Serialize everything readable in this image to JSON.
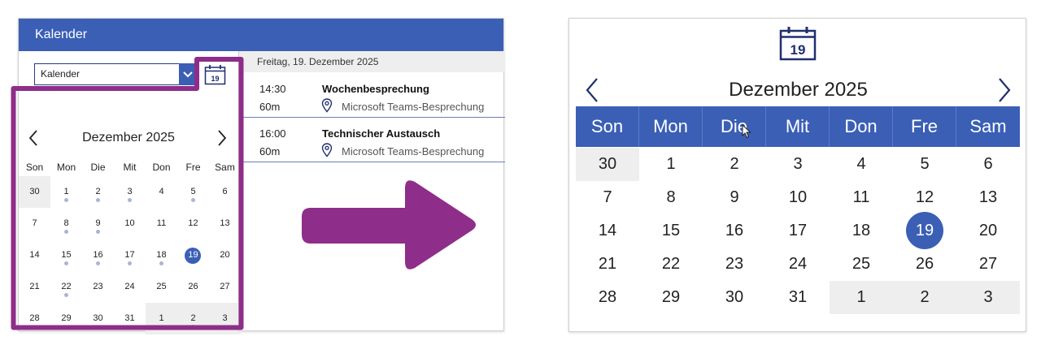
{
  "app": {
    "title": "Kalender",
    "calendar_select_value": "Kalender",
    "small_icon_day": "19",
    "agenda_date": "Freitag, 19. Dezember 2025",
    "events": [
      {
        "time": "14:30",
        "duration": "60m",
        "title": "Wochenbesprechung",
        "location": "Microsoft Teams-Besprechung"
      },
      {
        "time": "16:00",
        "duration": "60m",
        "title": "Technischer Austausch",
        "location": "Microsoft Teams-Besprechung"
      }
    ]
  },
  "calendar": {
    "month_label": "Dezember 2025",
    "weekdays": [
      "Son",
      "Mon",
      "Die",
      "Mit",
      "Don",
      "Fre",
      "Sam"
    ],
    "weeks": [
      [
        "30",
        "1",
        "2",
        "3",
        "4",
        "5",
        "6"
      ],
      [
        "7",
        "8",
        "9",
        "10",
        "11",
        "12",
        "13"
      ],
      [
        "14",
        "15",
        "16",
        "17",
        "18",
        "19",
        "20"
      ],
      [
        "21",
        "22",
        "23",
        "24",
        "25",
        "26",
        "27"
      ],
      [
        "28",
        "29",
        "30",
        "31",
        "1",
        "2",
        "3"
      ]
    ],
    "other_month_cells": [
      [
        0,
        0
      ],
      [
        4,
        4
      ],
      [
        4,
        5
      ],
      [
        4,
        6
      ]
    ],
    "selected_cell": [
      2,
      5
    ],
    "event_dot_cells": [
      [
        0,
        1
      ],
      [
        0,
        2
      ],
      [
        0,
        3
      ],
      [
        0,
        5
      ],
      [
        1,
        1
      ],
      [
        1,
        2
      ],
      [
        2,
        1
      ],
      [
        2,
        2
      ],
      [
        2,
        3
      ],
      [
        2,
        4
      ],
      [
        3,
        1
      ],
      [
        4,
        5
      ]
    ]
  },
  "zoom": {
    "icon_day": "19"
  },
  "colors": {
    "accent": "#3a5fb5",
    "highlight": "#8e2d8a",
    "other_month_bg": "#eeeeee",
    "event_dot": "#aab4d6"
  },
  "icons": [
    "calendar-icon",
    "chevron-down-icon",
    "chevron-left-icon",
    "chevron-right-icon",
    "location-pin-icon",
    "arrow-right-icon",
    "mouse-cursor-icon"
  ]
}
